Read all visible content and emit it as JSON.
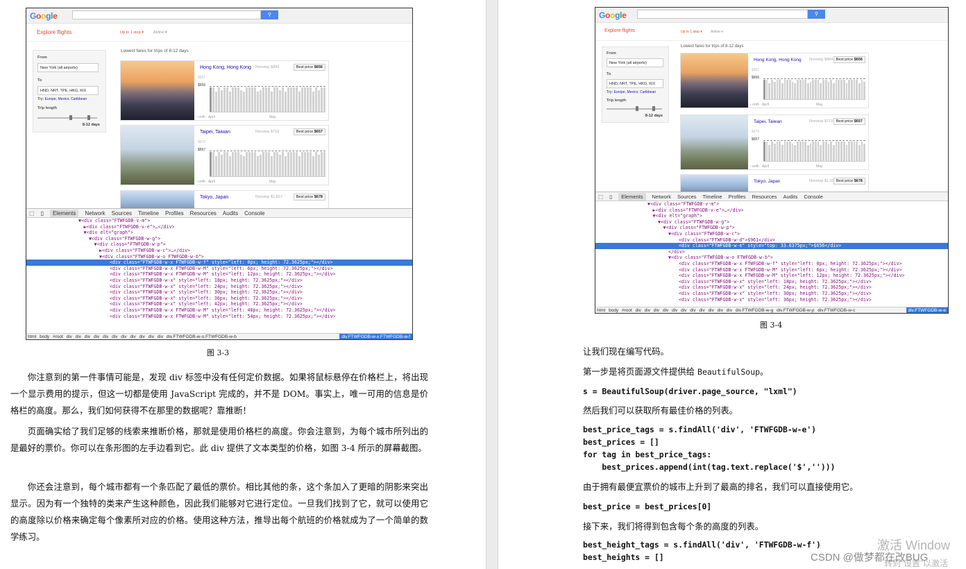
{
  "fig33": {
    "google_logo": "Google",
    "search_btn": "🔍",
    "explore": "Explore flights",
    "filter1": "Up to 1 stop ▾",
    "filter2": "Airline ▾",
    "from_label": "From",
    "from_value": "New York (all airports)",
    "to_label": "To",
    "to_value": "HND, NRT, TPE, HKG, KIX",
    "try_label": "Try:",
    "try_links": "Europe, Mexico, Caribbean",
    "trip_label": "Trip length",
    "trip_days": "8-12 days",
    "lowest": "Lowest fares for trips of 8-12 days",
    "cards": [
      {
        "city": "Hong Kong, Hong Kong",
        "nonstop": "Nonstop $884",
        "best_label": "Best price",
        "best_value": "$656",
        "y_top": "$961",
        "y_mid": "$656",
        "x1": "‹ onth · April",
        "x2": "May"
      },
      {
        "city": "Taipei, Taiwan",
        "nonstop": "Nonstop $719",
        "best_label": "Best price",
        "best_value": "$657",
        "y_top": "$679",
        "y_mid": "$657",
        "x1": "‹ onth · April",
        "x2": "May"
      },
      {
        "city": "Tokyo, Japan",
        "nonstop": "Nonstop $1,657",
        "best_label": "Best price",
        "best_value": "$678"
      }
    ],
    "tabs": [
      "Elements",
      "Network",
      "Sources",
      "Timeline",
      "Profiles",
      "Resources",
      "Audits",
      "Console"
    ],
    "code_lines": [
      {
        "indent": 10,
        "text": "▼<div class=\"FTWFGDB-v-m\">"
      },
      {
        "indent": 11,
        "text": "▶<div class=\"FTWFGDB-v-e\">…</div>"
      },
      {
        "indent": 11,
        "text": "▼<div elt=\"graph\">"
      },
      {
        "indent": 12,
        "text": "▼<div class=\"FTWFGDB-w-g\">"
      },
      {
        "indent": 13,
        "text": "▼<div class=\"FTWFGDB-w-p\">"
      },
      {
        "indent": 14,
        "text": "▶<div class=\"FTWFGDB-w-c\">…</div>"
      },
      {
        "indent": 14,
        "text": "▼<div class=\"FTWFGDB-w-o FTWFGDB-w-b\">"
      },
      {
        "indent": 16,
        "text": "<div class=\"FTWFGDB-w-x FTWFGDB-w-f\" style=\"left: 0px; height: 72.3625px;\"></div>",
        "sel": true
      },
      {
        "indent": 16,
        "text": "<div class=\"FTWFGDB-w-x FTWFGDB-w-M\" style=\"left: 6px; height: 72.3625px;\"></div>"
      },
      {
        "indent": 16,
        "text": "<div class=\"FTWFGDB-w-x FTWFGDB-w-M\" style=\"left: 12px; height: 72.3625px;\"></div>"
      },
      {
        "indent": 16,
        "text": "<div class=\"FTWFGDB-w-x\" style=\"left: 18px; height: 72.3625px;\"></div>"
      },
      {
        "indent": 16,
        "text": "<div class=\"FTWFGDB-w-x\" style=\"left: 24px; height: 72.3625px;\"></div>"
      },
      {
        "indent": 16,
        "text": "<div class=\"FTWFGDB-w-x\" style=\"left: 30px; height: 72.3625px;\"></div>"
      },
      {
        "indent": 16,
        "text": "<div class=\"FTWFGDB-w-x\" style=\"left: 36px; height: 72.3625px;\"></div>"
      },
      {
        "indent": 16,
        "text": "<div class=\"FTWFGDB-w-x\" style=\"left: 42px; height: 72.3625px;\"></div>"
      },
      {
        "indent": 16,
        "text": "<div class=\"FTWFGDB-w-x FTWFGDB-w-M\" style=\"left: 48px; height: 72.3625px;\"></div>"
      },
      {
        "indent": 16,
        "text": "<div class=\"FTWFGDB-w-x FTWFGDB-w-M\" style=\"left: 54px; height: 72.3625px;\"></div>"
      }
    ],
    "crumbs": "html  body  #root  div  div  div  div  div  div  div  div  div  div  div  div.FTWFGDB-w-o.FTWFGDB-w-b",
    "crumb_last": "div.FTWFGDB-w-x.FTWFGDB-w-f"
  },
  "cap33": "图 3-3",
  "para1": "你注意到的第一件事情可能是，发现 div 标签中没有任何定价数据。如果将鼠标悬停在价格栏上，将出现一个显示费用的提示，但这一切都是使用 JavaScript 完成的，并不是 DOM。事实上，唯一可用的信息是价格栏的高度。那么，我们如何获得不在那里的数据呢？靠推断！",
  "para2": "页面确实给了我们足够的线索来推断价格，那就是使用价格栏的高度。你会注意到，为每个城市所列出的是最好的票价。你可以在条形图的左手边看到它。此 div 提供了文本类型的价格，如图 3-4 所示的屏幕截图。",
  "para3": "你还会注意到，每个城市都有一个条匹配了最低的票价。相比其他的条，这个条加入了更暗的阴影来突出显示。因为有一个独特的类来产生这种颜色，因此我们能够对它进行定位。一旦我们找到了它，就可以使用它的高度除以价格来确定每个像素所对应的价格。使用这种方法，推导出每个航班的价格就成为了一个简单的数学练习。",
  "fig34": {
    "cards": [
      {
        "city": "Hong Kong, Hong Kong",
        "nonstop": "Nonstop $884",
        "best_label": "Best price",
        "best_value": "$656",
        "y_top": "$961",
        "y_mid": "$656",
        "x1": "‹ onth · April",
        "x2": "May"
      },
      {
        "city": "Taipei, Taiwan",
        "nonstop": "Nonstop $719",
        "best_label": "Best price",
        "best_value": "$657",
        "y_top": "$679",
        "y_mid": "$657",
        "x1": "‹ onth · April",
        "x2": "May"
      },
      {
        "city": "Tokyo, Japan",
        "nonstop": "Nonstop $1,657",
        "best_label": "Best price",
        "best_value": "$678"
      }
    ],
    "code_lines": [
      {
        "indent": 10,
        "text": "▼<div class=\"FTWFGDB-v-m\">"
      },
      {
        "indent": 11,
        "text": "▶<div class=\"FTWFGDB-v-e\">…</div>"
      },
      {
        "indent": 11,
        "text": "▼<div elt=\"graph\">"
      },
      {
        "indent": 12,
        "text": "▼<div class=\"FTWFGDB-w-g\">"
      },
      {
        "indent": 13,
        "text": "▼<div class=\"FTWFGDB-w-p\">"
      },
      {
        "indent": 14,
        "text": "▼<div class=\"FTWFGDB-w-c\">"
      },
      {
        "indent": 16,
        "text": "<div class=\"FTWFGDB-w-d\">$961</div>"
      },
      {
        "indent": 16,
        "text": "<div class=\"FTWFGDB-w-e\" style=\"top: 33.6375px;\">$656</div>",
        "sel": true
      },
      {
        "indent": 14,
        "text": "</div>"
      },
      {
        "indent": 14,
        "text": "▼<div class=\"FTWFGDB-w-o FTWFGDB-w-b\">"
      },
      {
        "indent": 16,
        "text": "<div class=\"FTWFGDB-w-x FTWFGDB-w-f\" style=\"left: 0px; height: 72.3625px;\"></div>"
      },
      {
        "indent": 16,
        "text": "<div class=\"FTWFGDB-w-x FTWFGDB-w-M\" style=\"left: 6px; height: 72.3625px;\"></div>"
      },
      {
        "indent": 16,
        "text": "<div class=\"FTWFGDB-w-x FTWFGDB-w-M\" style=\"left: 12px; height: 72.3625px;\"></div>"
      },
      {
        "indent": 16,
        "text": "<div class=\"FTWFGDB-w-x\" style=\"left: 18px; height: 72.3625px;\"></div>"
      },
      {
        "indent": 16,
        "text": "<div class=\"FTWFGDB-w-x\" style=\"left: 24px; height: 72.3625px;\"></div>"
      },
      {
        "indent": 16,
        "text": "<div class=\"FTWFGDB-w-x\" style=\"left: 30px; height: 72.3625px;\"></div>"
      },
      {
        "indent": 16,
        "text": "<div class=\"FTWFGDB-w-x\" style=\"left: 36px; height: 72.3625px;\"></div>"
      }
    ],
    "crumbs": "html  body  #root  div  div  div  div  div  div  div  div  div  div  div  div.FTWFGDB-w-g  div.FTWFGDB-w-p  div.FTWFGDB-w-c",
    "crumb_last": "div.FTWFGDB-w-e"
  },
  "cap34": "图 3-4",
  "r_line1": "让我们现在编写代码。",
  "r_line2a": "第一步是将页面源文件提供给 ",
  "r_line2b": "BeautifulSoup",
  "r_line2c": "。",
  "code1": "s = BeautifulSoup(driver.page_source, \"lxml\")",
  "r_line3": "然后我们可以获取所有最佳价格的列表。",
  "code2": "best_price_tags = s.findAll('div', 'FTWFGDB-w-e')\nbest_prices = []\nfor tag in best_price_tags:\n    best_prices.append(int(tag.text.replace('$','')))",
  "r_line4": "由于拥有最便宜票价的城市上升到了最高的排名，我们可以直接使用它。",
  "code3": "best_price = best_prices[0]",
  "r_line5": "接下来，我们将得到包含每个条的高度的列表。",
  "code4": "best_height_tags = s.findAll('div', 'FTWFGDB-w-f')\nbest_heights = []",
  "wm1": "激活 Window",
  "wm2": "CSDN @做梦都在改BUG",
  "wm3": "转到“设置”以激活"
}
